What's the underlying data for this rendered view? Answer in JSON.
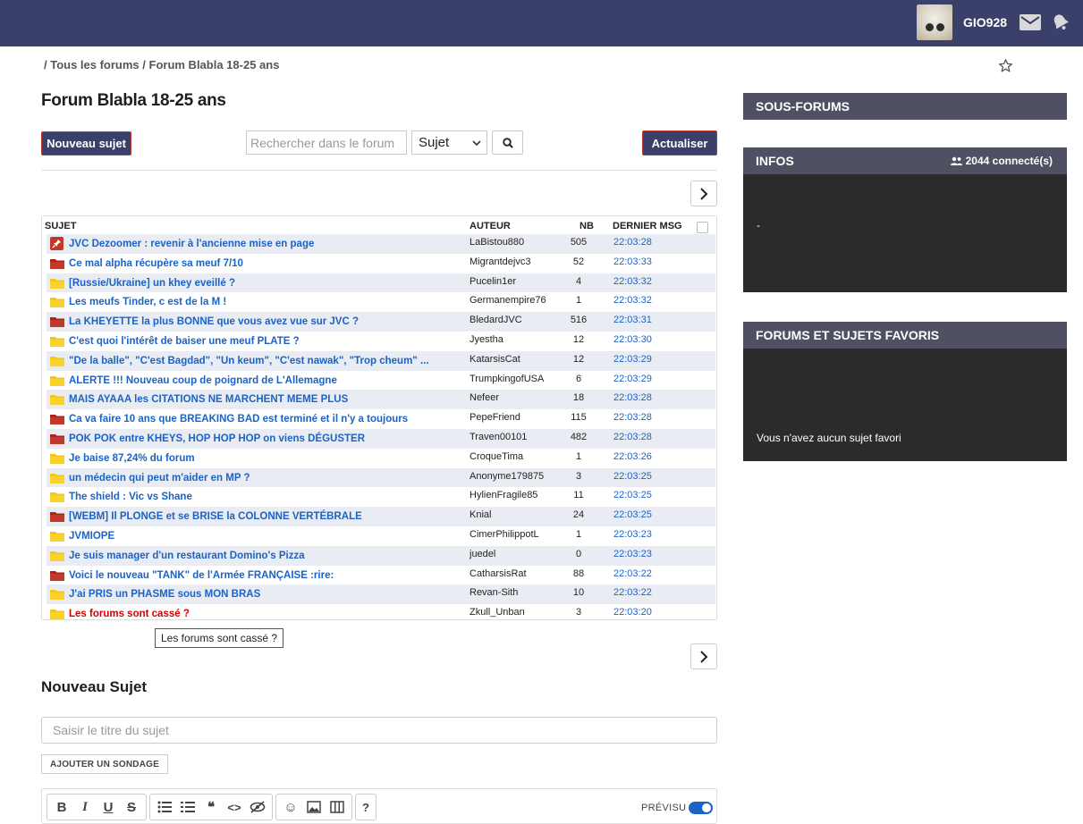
{
  "header": {
    "username": "GIO928"
  },
  "breadcrumb": {
    "text": "/ Tous les forums / Forum Blabla 18-25 ans"
  },
  "page_title": "Forum Blabla 18-25 ans",
  "toolbar": {
    "new_topic_label": "Nouveau sujet",
    "search_placeholder": "Rechercher dans le forum",
    "search_scope": "Sujet",
    "refresh_label": "Actualiser"
  },
  "table": {
    "headers": {
      "subject": "SUJET",
      "author": "AUTEUR",
      "count": "NB",
      "last": "DERNIER MSG"
    },
    "rows": [
      {
        "icon": "pin",
        "title": "JVC Dezoomer : revenir à l'ancienne mise en page",
        "author": "LaBistou880",
        "nb": "505",
        "time": "22:03:28"
      },
      {
        "icon": "folder-red",
        "title": "Ce mal alpha récupère sa meuf 7/10",
        "author": "Migrantdejvc3",
        "nb": "52",
        "time": "22:03:33"
      },
      {
        "icon": "folder-yellow",
        "title": "[Russie/Ukraine] un khey eveillé ?",
        "author": "Pucelin1er",
        "nb": "4",
        "time": "22:03:32"
      },
      {
        "icon": "folder-yellow",
        "title": "Les meufs Tinder, c est de la M !",
        "author": "Germanempire76",
        "nb": "1",
        "time": "22:03:32"
      },
      {
        "icon": "folder-red",
        "title": "La KHEYETTE la plus BONNE que vous avez vue sur JVC ?",
        "author": "BledardJVC",
        "nb": "516",
        "time": "22:03:31"
      },
      {
        "icon": "folder-yellow",
        "title": "C'est quoi l'intérêt de baiser une meuf PLATE ?",
        "author": "Jyestha",
        "nb": "12",
        "time": "22:03:30"
      },
      {
        "icon": "folder-yellow",
        "title": "\"De la balle\", \"C'est Bagdad\", \"Un keum\", \"C'est nawak\", \"Trop cheum\" ...",
        "author": "KatarsisCat",
        "nb": "12",
        "time": "22:03:29"
      },
      {
        "icon": "folder-yellow",
        "title": "ALERTE !!! Nouveau coup de poignard de L'Allemagne",
        "author": "TrumpkingofUSA",
        "nb": "6",
        "time": "22:03:29"
      },
      {
        "icon": "folder-yellow",
        "title": "MAIS AYAAA les CITATIONS NE MARCHENT MEME PLUS",
        "author": "Nefeer",
        "nb": "18",
        "time": "22:03:28"
      },
      {
        "icon": "folder-red",
        "title": "Ca va faire 10 ans que BREAKING BAD est terminé et il n'y a toujours",
        "author": "PepeFriend",
        "nb": "115",
        "time": "22:03:28"
      },
      {
        "icon": "folder-red",
        "title": "POK POK entre KHEYS, HOP HOP HOP on viens DÉGUSTER",
        "author": "Traven00101",
        "nb": "482",
        "time": "22:03:28"
      },
      {
        "icon": "folder-yellow",
        "title": "Je baise 87,24% du forum",
        "author": "CroqueTima",
        "nb": "1",
        "time": "22:03:26"
      },
      {
        "icon": "folder-yellow",
        "title": "un médecin qui peut m'aider en MP ?",
        "author": "Anonyme179875",
        "nb": "3",
        "time": "22:03:25"
      },
      {
        "icon": "folder-yellow",
        "title": "The shield : Vic vs Shane",
        "author": "HylienFragile85",
        "nb": "11",
        "time": "22:03:25"
      },
      {
        "icon": "folder-red",
        "title": "[WEBM] Il PLONGE et se BRISE la COLONNE VERTÉBRALE",
        "author": "Knial",
        "nb": "24",
        "time": "22:03:25"
      },
      {
        "icon": "folder-yellow",
        "title": "JVMIOPE",
        "author": "CimerPhilippotL",
        "nb": "1",
        "time": "22:03:23"
      },
      {
        "icon": "folder-yellow",
        "title": "Je suis manager d'un restaurant Domino's Pizza",
        "author": "juedel",
        "nb": "0",
        "time": "22:03:23"
      },
      {
        "icon": "folder-red",
        "title": "Voici le nouveau \"TANK\" de l'Armée FRANÇAISE :rire:",
        "author": "CatharsisRat",
        "nb": "88",
        "time": "22:03:22"
      },
      {
        "icon": "folder-yellow",
        "title": "J'ai PRIS un PHASME sous MON BRAS",
        "author": "Revan-Sith",
        "nb": "10",
        "time": "22:03:22"
      },
      {
        "icon": "folder-yellow",
        "title": "Les forums sont cassé ?",
        "author": "Zkull_Unban",
        "nb": "3",
        "time": "22:03:20",
        "red": true
      }
    ]
  },
  "tooltip": "Les forums sont cassé ?",
  "new_topic": {
    "section_title": "Nouveau Sujet",
    "title_placeholder": "Saisir le titre du sujet",
    "poll_label": "AJOUTER UN SONDAGE",
    "preview_label": "PRÉVISU",
    "preview_enabled": true
  },
  "sidebar": {
    "subforums_title": "SOUS-FORUMS",
    "infos_title": "INFOS",
    "connected": "2044 connecté(s)",
    "infos_body": "-",
    "favorites_title": "FORUMS ET SUJETS FAVORIS",
    "favorites_empty": "Vous n'avez aucun sujet favori"
  },
  "colors": {
    "topbar": "#3a4069",
    "link": "#1b63c6",
    "hot_red": "#c0392b",
    "folder_yellow": "#f5c518",
    "panel_head": "#4f5163",
    "panel_body": "#2b2b2b"
  }
}
